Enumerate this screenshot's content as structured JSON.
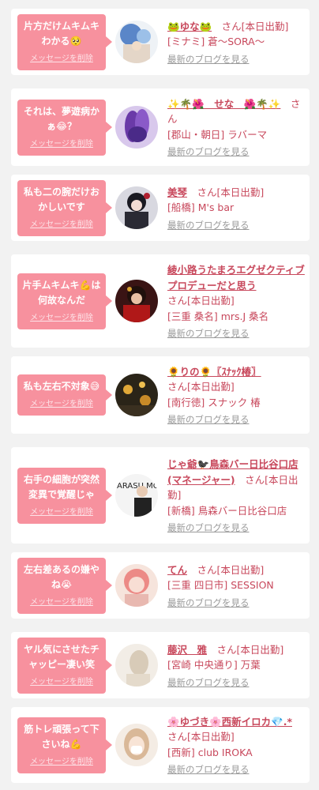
{
  "items": [
    {
      "message": "片方だけムキムキわかる🥺",
      "delete_label": "メッセージを削除",
      "name": "🐸ゆな🐸",
      "san_tag": "　さん[本日出勤]",
      "area_shop": "[ミナミ] 蒼〜SORA〜",
      "blog_label": "最新のブログを見る",
      "avatar_colors": [
        "#7fb2d8",
        "#e8d8c4"
      ]
    },
    {
      "message": "それは、夢遊病かぁ😂？",
      "delete_label": "メッセージを削除",
      "name": "✨🌴🌺　せな　🌺🌴✨",
      "san_tag": "　さん",
      "area_shop": "[郡山・朝日] ラバーマ",
      "blog_label": "最新のブログを見る",
      "avatar_colors": [
        "#6a4aa8",
        "#c8b0e8"
      ]
    },
    {
      "message": "私も二の腕だけおかしいです",
      "delete_label": "メッセージを削除",
      "name": "美琴",
      "san_tag": "　さん[本日出勤]",
      "area_shop": "[船橋] M's bar",
      "blog_label": "最新のブログを見る",
      "avatar_colors": [
        "#2a2a30",
        "#e8d0d0"
      ]
    },
    {
      "message": "片手ムキムキ💪は何故なんだ",
      "delete_label": "メッセージを削除",
      "name": "綾小路うたまろエグゼクティブプロデューだと思う",
      "san_tag": "さん[本日出勤]",
      "area_shop": "[三重 桑名] mrs.J 桑名",
      "blog_label": "最新のブログを見る",
      "avatar_colors": [
        "#8a1818",
        "#e0b090"
      ]
    },
    {
      "message": "私も左右不対象😅",
      "delete_label": "メッセージを削除",
      "name": "🌻りの🌻〖ｽﾅｯｸ椿〗",
      "san_tag": "さん[本日出勤]",
      "area_shop": "[南行徳] スナック 椿",
      "blog_label": "最新のブログを見る",
      "avatar_colors": [
        "#3a3020",
        "#d8a040"
      ]
    },
    {
      "message": "右手の細胞が突然変異で覚醒じゃ",
      "delete_label": "メッセージを削除",
      "name": "じゃ爺🐦‍⬛鳥森バー日比谷口店(マネージャー)",
      "san_tag": "　さん[本日出勤]",
      "area_shop": "[新橋] 鳥森バー日比谷口店",
      "blog_label": "最新のブログを見る",
      "avatar_colors": [
        "#f0f0f0",
        "#222222"
      ],
      "avatar_text": "ARASU MO BAI"
    },
    {
      "message": "左右差あるの嫌やね😭",
      "delete_label": "メッセージを削除",
      "name": "てん",
      "san_tag": "　さん[本日出勤]",
      "area_shop": "[三重 四日市] SESSION",
      "blog_label": "最新のブログを見る",
      "avatar_colors": [
        "#f08a8a",
        "#f6dcd0"
      ]
    },
    {
      "message": "ヤル気にさせたチャッピー凄い笑",
      "delete_label": "メッセージを削除",
      "name": "藤沢　雅",
      "san_tag": "　さん[本日出勤]",
      "area_shop": "[宮崎 中央通り] 万葉",
      "blog_label": "最新のブログを見る",
      "avatar_colors": [
        "#efe8e0",
        "#cfc2b0"
      ]
    },
    {
      "message": "筋トレ頑張って下さいね💪",
      "delete_label": "メッセージを削除",
      "name": "🌸ゆづき🌸西新イロカ💎.*",
      "san_tag": "　さん[本日出勤]",
      "area_shop": "[西新] club IROKA",
      "blog_label": "最新のブログを見る",
      "avatar_colors": [
        "#e8d0b8",
        "#ffffff"
      ]
    }
  ]
}
